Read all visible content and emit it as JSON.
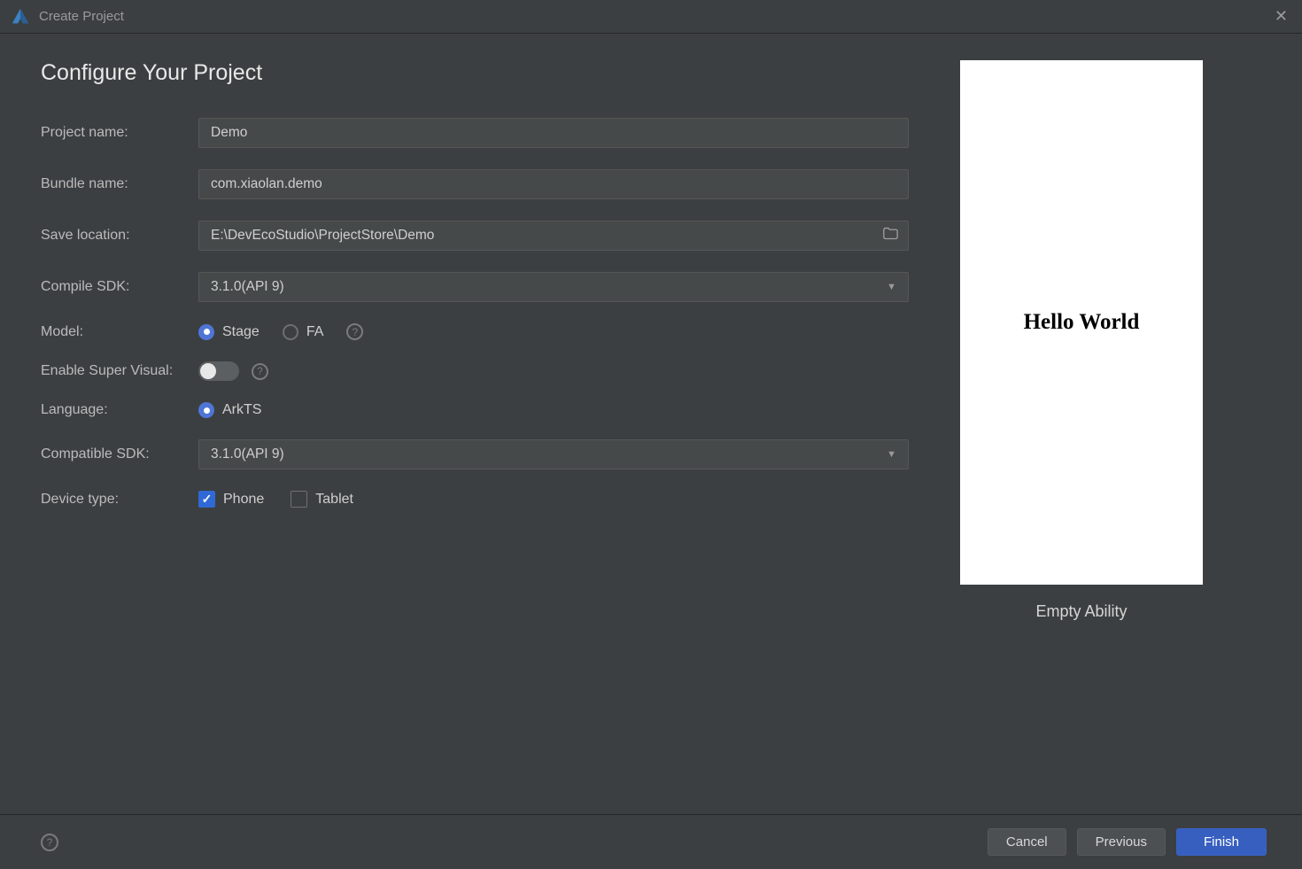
{
  "window": {
    "title": "Create Project"
  },
  "header": {
    "title": "Configure Your Project"
  },
  "form": {
    "projectName": {
      "label": "Project name:",
      "value": "Demo"
    },
    "bundleName": {
      "label": "Bundle name:",
      "value": "com.xiaolan.demo"
    },
    "saveLocation": {
      "label": "Save location:",
      "value": "E:\\DevEcoStudio\\ProjectStore\\Demo"
    },
    "compileSDK": {
      "label": "Compile SDK:",
      "value": "3.1.0(API 9)"
    },
    "model": {
      "label": "Model:",
      "options": [
        "Stage",
        "FA"
      ],
      "selected": "Stage"
    },
    "superVisual": {
      "label": "Enable Super Visual:",
      "enabled": false
    },
    "language": {
      "label": "Language:",
      "options": [
        "ArkTS"
      ],
      "selected": "ArkTS"
    },
    "compatibleSDK": {
      "label": "Compatible SDK:",
      "value": "3.1.0(API 9)"
    },
    "deviceType": {
      "label": "Device type:",
      "options": [
        {
          "name": "Phone",
          "checked": true
        },
        {
          "name": "Tablet",
          "checked": false
        }
      ]
    }
  },
  "preview": {
    "text": "Hello World",
    "caption": "Empty Ability"
  },
  "buttons": {
    "cancel": "Cancel",
    "previous": "Previous",
    "finish": "Finish"
  }
}
